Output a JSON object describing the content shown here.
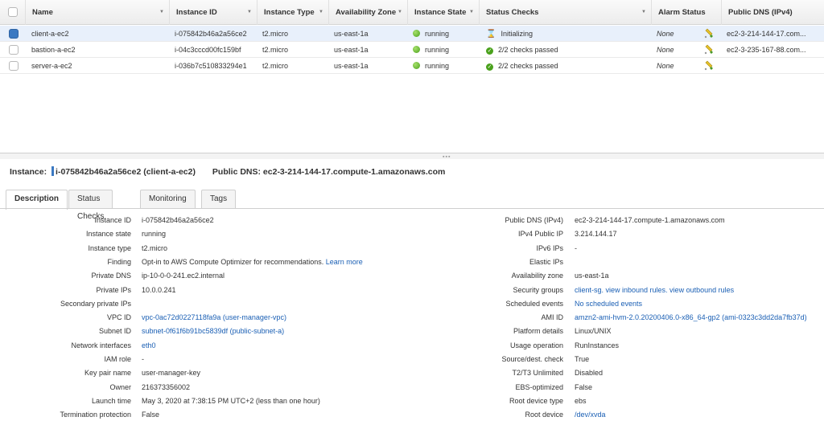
{
  "table": {
    "headers": {
      "name": "Name",
      "instance_id": "Instance ID",
      "instance_type": "Instance Type",
      "az": "Availability Zone",
      "state": "Instance State",
      "status_checks": "Status Checks",
      "alarm_status": "Alarm Status",
      "public_dns": "Public DNS (IPv4)"
    },
    "rows": [
      {
        "name": "client-a-ec2",
        "instance_id": "i-075842b46a2a56ce2",
        "instance_type": "t2.micro",
        "az": "us-east-1a",
        "state": "running",
        "status": "Initializing",
        "alarm": "None",
        "dns": "ec2-3-214-144-17.com..."
      },
      {
        "name": "bastion-a-ec2",
        "instance_id": "i-04c3cccd00fc159bf",
        "instance_type": "t2.micro",
        "az": "us-east-1a",
        "state": "running",
        "status": "2/2 checks passed",
        "alarm": "None",
        "dns": "ec2-3-235-167-88.com..."
      },
      {
        "name": "server-a-ec2",
        "instance_id": "i-036b7c510833294e1",
        "instance_type": "t2.micro",
        "az": "us-east-1a",
        "state": "running",
        "status": "2/2 checks passed",
        "alarm": "None",
        "dns": ""
      }
    ]
  },
  "details": {
    "instance_label": "Instance:",
    "instance_value": "i-075842b46a2a56ce2 (client-a-ec2)",
    "dns_label": "Public DNS:",
    "dns_value": "ec2-3-214-144-17.compute-1.amazonaws.com"
  },
  "tabs": [
    "Description",
    "Status Checks",
    "Monitoring",
    "Tags"
  ],
  "description": {
    "left": [
      {
        "label": "Instance ID",
        "value": "i-075842b46a2a56ce2"
      },
      {
        "label": "Instance state",
        "value": "running"
      },
      {
        "label": "Instance type",
        "value": "t2.micro"
      },
      {
        "label": "Finding",
        "value": "Opt-in to AWS Compute Optimizer for recommendations.",
        "link": "Learn more"
      },
      {
        "label": "Private DNS",
        "value": "ip-10-0-0-241.ec2.internal"
      },
      {
        "label": "Private IPs",
        "value": "10.0.0.241"
      },
      {
        "label": "Secondary private IPs",
        "value": ""
      },
      {
        "label": "VPC ID",
        "link": "vpc-0ac72d0227118fa9a (user-manager-vpc)"
      },
      {
        "label": "Subnet ID",
        "link": "subnet-0f61f6b91bc5839df (public-subnet-a)"
      },
      {
        "label": "Network interfaces",
        "link": "eth0"
      },
      {
        "label": "IAM role",
        "value": "-"
      },
      {
        "label": "Key pair name",
        "value": "user-manager-key"
      },
      {
        "label": "Owner",
        "value": "216373356002"
      },
      {
        "label": "Launch time",
        "value": "May 3, 2020 at 7:38:15 PM UTC+2 (less than one hour)"
      },
      {
        "label": "Termination protection",
        "value": "False"
      }
    ],
    "right": [
      {
        "label": "Public DNS (IPv4)",
        "value": "ec2-3-214-144-17.compute-1.amazonaws.com"
      },
      {
        "label": "IPv4 Public IP",
        "value": "3.214.144.17"
      },
      {
        "label": "IPv6 IPs",
        "value": "-"
      },
      {
        "label": "Elastic IPs",
        "value": ""
      },
      {
        "label": "Availability zone",
        "value": "us-east-1a"
      },
      {
        "label": "Security groups",
        "link": "client-sg. view inbound rules. view outbound rules"
      },
      {
        "label": "Scheduled events",
        "link": "No scheduled events"
      },
      {
        "label": "AMI ID",
        "link": "amzn2-ami-hvm-2.0.20200406.0-x86_64-gp2 (ami-0323c3dd2da7fb37d)"
      },
      {
        "label": "Platform details",
        "value": "Linux/UNIX"
      },
      {
        "label": "Usage operation",
        "value": "RunInstances"
      },
      {
        "label": "Source/dest. check",
        "value": "True"
      },
      {
        "label": "T2/T3 Unlimited",
        "value": "Disabled"
      },
      {
        "label": "EBS-optimized",
        "value": "False"
      },
      {
        "label": "Root device type",
        "value": "ebs"
      },
      {
        "label": "Root device",
        "link": "/dev/xvda"
      }
    ]
  },
  "colors": {
    "accent": "#3b79c2",
    "link": "#1a5fb4",
    "running": "#4aa11c"
  }
}
